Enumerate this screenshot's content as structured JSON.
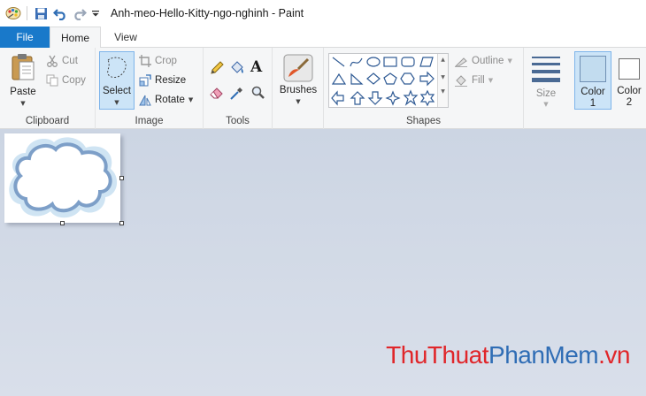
{
  "window": {
    "title": "Anh-meo-Hello-Kitty-ngo-nghinh - Paint"
  },
  "tabs": {
    "file": "File",
    "home": "Home",
    "view": "View"
  },
  "clipboard": {
    "paste": "Paste",
    "cut": "Cut",
    "copy": "Copy",
    "label": "Clipboard"
  },
  "image": {
    "select": "Select",
    "crop": "Crop",
    "resize": "Resize",
    "rotate": "Rotate",
    "label": "Image"
  },
  "tools": {
    "label": "Tools"
  },
  "brushes": {
    "label": "Brushes"
  },
  "shapes": {
    "outline": "Outline",
    "fill": "Fill",
    "label": "Shapes"
  },
  "size": {
    "label": "Size"
  },
  "colors": {
    "color1_line1": "Color",
    "color1_line2": "1",
    "color2_line1": "Color",
    "color2_line2": "2",
    "color1_value": "#c2dcef",
    "color2_value": "#ffffff"
  },
  "watermark": {
    "part1": "ThuThuat",
    "part2": "PhanMem",
    "part3": ".vn"
  }
}
